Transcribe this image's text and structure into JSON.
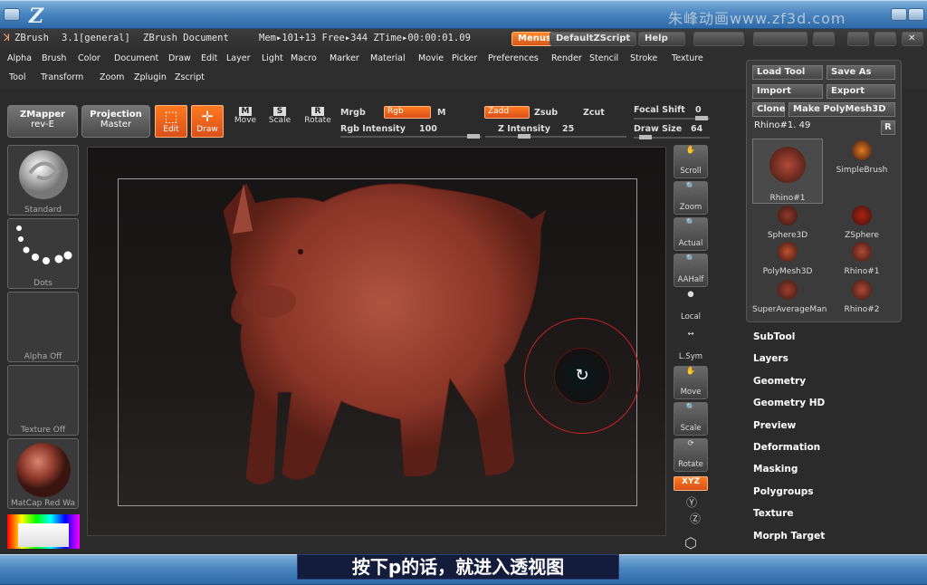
{
  "window": {
    "logo": "Z",
    "watermark": "朱峰动画www.zf3d.com"
  },
  "titlebar": {
    "app": "ZBrush",
    "version": "3.1[general]",
    "document": "ZBrush Document",
    "mem": "Mem▸101+13 Free▸344 ZTime▸00:00:01.09",
    "menus_btn": "Menus",
    "script_btn": "DefaultZScript",
    "help_btn": "Help"
  },
  "menu": {
    "row1": [
      "Alpha",
      "Brush",
      "Color",
      "Document",
      "Draw",
      "Edit",
      "Layer",
      "Light",
      "Macro",
      "Marker",
      "Material",
      "Movie",
      "Picker",
      "Preferences",
      "Render",
      "Stencil",
      "Stroke",
      "Texture"
    ],
    "row2": [
      "Tool",
      "Transform",
      "Zoom",
      "Zplugin",
      "Zscript"
    ]
  },
  "toolbar": {
    "zmapper": "ZMapper",
    "zmapper_sub": "rev-E",
    "projection": "Projection",
    "projection_sub": "Master",
    "edit": "Edit",
    "draw": "Draw",
    "move": "Move",
    "scale": "Scale",
    "rotate": "Rotate",
    "mrgb": "Mrgb",
    "rgb": "Rgb",
    "m": "M",
    "rgb_intensity_label": "Rgb Intensity",
    "rgb_intensity": "100",
    "zadd": "Zadd",
    "zsub": "Zsub",
    "zcut": "Zcut",
    "z_intensity_label": "Z Intensity",
    "z_intensity": "25",
    "focal_label": "Focal Shift",
    "focal": "0",
    "drawsize_label": "Draw Size",
    "drawsize": "64"
  },
  "left": {
    "standard": "Standard",
    "dots": "Dots",
    "alpha": "Alpha Off",
    "texture": "Texture Off",
    "matcap": "MatCap Red Wa"
  },
  "nav": {
    "scroll": "Scroll",
    "zoom": "Zoom",
    "actual": "Actual",
    "aahalf": "AAHalf",
    "local": "Local",
    "lsym": "L.Sym",
    "move": "Move",
    "scale": "Scale",
    "rotate": "Rotate",
    "xyz": "XYZ"
  },
  "toolpanel": {
    "load": "Load Tool",
    "save": "Save As",
    "import": "Import",
    "export": "Export",
    "clone": "Clone",
    "make": "Make PolyMesh3D",
    "current": "Rhino#1. 49",
    "r": "R",
    "items": [
      "Rhino#1",
      "SimpleBrush",
      "Sphere3D",
      "ZSphere",
      "PolyMesh3D",
      "Rhino#1",
      "SuperAverageMan",
      "Rhino#2"
    ]
  },
  "sidemenu": [
    "SubTool",
    "Layers",
    "Geometry",
    "Geometry HD",
    "Preview",
    "Deformation",
    "Masking",
    "Polygroups",
    "Texture",
    "Morph Target"
  ],
  "subtitle": "按下p的话，就进入透视图",
  "colors": {
    "accent": "#ff7a20",
    "model": "#8e3a2c"
  }
}
